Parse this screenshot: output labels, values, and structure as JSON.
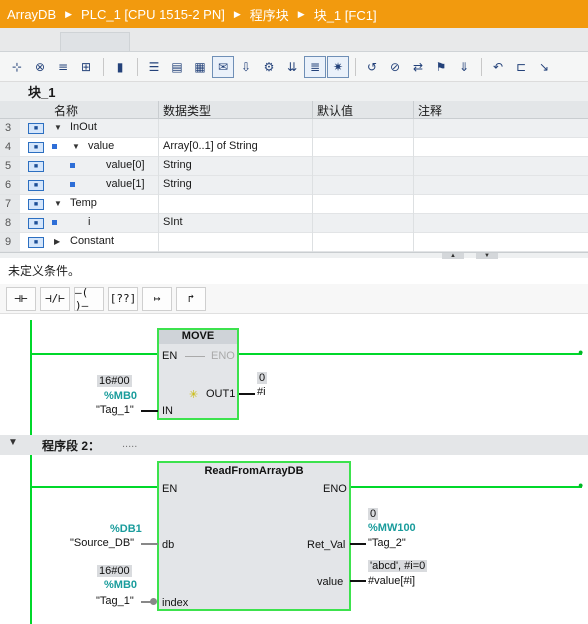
{
  "breadcrumb": {
    "items": [
      "ArrayDB",
      "PLC_1 [CPU 1515-2 PN]",
      "程序块",
      "块_1 [FC1]"
    ],
    "separator": "▶"
  },
  "toolbar": {
    "icons": [
      "insert-network-icon",
      "delete-network-icon",
      "insert-row-icon",
      "add-row-icon",
      "display-icon",
      "absolute-operands-icon",
      "favorites-icon",
      "layout-icon",
      "comments-icon",
      "zoom-icon",
      "monitor-icon",
      "expand-icon",
      "list-icon",
      "dock-icon",
      "pin-icon",
      "open-block-icon",
      "goto-icon",
      "compile-icon",
      "download-icon",
      "upload-icon",
      "tag-icon",
      "extra-icon"
    ]
  },
  "block": {
    "title": "块_1"
  },
  "interface": {
    "columns": [
      "名称",
      "数据类型",
      "默认值",
      "注释"
    ],
    "rows": [
      {
        "num": "3",
        "pin": "■",
        "expand": "▼",
        "name": "InOut",
        "type": "",
        "level": 0,
        "dot": false,
        "shaded": true
      },
      {
        "num": "4",
        "pin": "■",
        "expand": "▼",
        "name": "value",
        "type": "Array[0..1] of String",
        "level": 1,
        "dot": true,
        "shaded": false
      },
      {
        "num": "5",
        "pin": "■",
        "expand": "",
        "name": "value[0]",
        "type": "String",
        "level": 2,
        "dot": true,
        "shaded": true
      },
      {
        "num": "6",
        "pin": "■",
        "expand": "",
        "name": "value[1]",
        "type": "String",
        "level": 2,
        "dot": true,
        "shaded": true
      },
      {
        "num": "7",
        "pin": "■",
        "expand": "▼",
        "name": "Temp",
        "type": "",
        "level": 0,
        "dot": false,
        "shaded": false
      },
      {
        "num": "8",
        "pin": "■",
        "expand": "",
        "name": "i",
        "type": "SInt",
        "level": 1,
        "dot": true,
        "shaded": true
      },
      {
        "num": "9",
        "pin": "■",
        "expand": "▶",
        "name": "Constant",
        "type": "",
        "level": 0,
        "dot": false,
        "shaded": false
      }
    ]
  },
  "condition_text": "未定义条件。",
  "ladder_toolbar": {
    "buttons": [
      "⊣⊢",
      "⊣/⊢",
      "–( )–",
      "[??]",
      "↦",
      "↱"
    ]
  },
  "network1": {
    "box": {
      "title": "MOVE",
      "en": "EN",
      "eno": "ENO",
      "out1": "OUT1",
      "in": "IN"
    },
    "in_value": "16#00",
    "in_address": "%MB0",
    "in_tag": "\"Tag_1\"",
    "out_value": "0",
    "out_tag": "#i"
  },
  "network2": {
    "header": "程序段 2：",
    "header_dots": ".....",
    "box": {
      "title": "ReadFromArrayDB",
      "en": "EN",
      "eno": "ENO",
      "db": "db",
      "index": "index",
      "ret_val": "Ret_Val",
      "value": "value"
    },
    "db_address": "%DB1",
    "db_tag": "\"Source_DB\"",
    "index_value": "16#00",
    "index_address": "%MB0",
    "index_tag": "\"Tag_1\"",
    "ret_value": "0",
    "ret_address": "%MW100",
    "ret_tag": "\"Tag_2\"",
    "value_monitor": "'abcd', #i=0",
    "value_tag": "#value[#i]"
  },
  "colors": {
    "title_bar": "#f29a0e",
    "rail": "#00d82a",
    "box_border": "#3ce24d",
    "address": "#1a9c9c"
  }
}
